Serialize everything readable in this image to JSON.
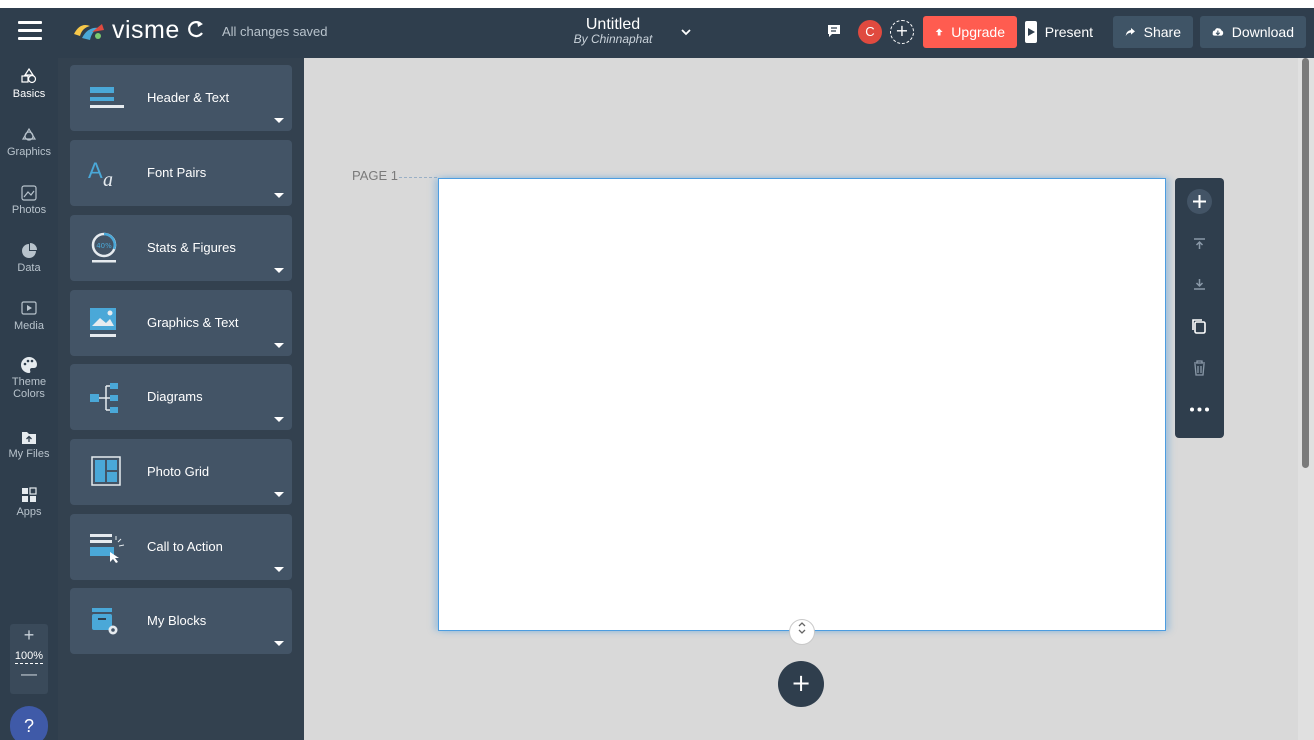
{
  "topbar": {
    "logo": "visme",
    "saved_status": "All changes saved",
    "doc_title": "Untitled",
    "doc_author": "By Chinnaphat",
    "avatar_initial": "C",
    "upgrade": "Upgrade",
    "present": "Present",
    "share": "Share",
    "download": "Download"
  },
  "rail": {
    "items": [
      {
        "label": "Basics",
        "icon": "basics-icon"
      },
      {
        "label": "Graphics",
        "icon": "graphics-icon"
      },
      {
        "label": "Photos",
        "icon": "photos-icon"
      },
      {
        "label": "Data",
        "icon": "data-icon"
      },
      {
        "label": "Media",
        "icon": "media-icon"
      },
      {
        "label": "Theme",
        "label2": "Colors",
        "icon": "palette-icon"
      },
      {
        "label": "My Files",
        "icon": "my-files-icon"
      },
      {
        "label": "Apps",
        "icon": "apps-icon"
      }
    ],
    "zoom_plus": "+",
    "zoom_value": "100%",
    "zoom_minus": "—",
    "help": "?"
  },
  "blocks": [
    {
      "label": "Header & Text"
    },
    {
      "label": "Font Pairs"
    },
    {
      "label": "Stats & Figures"
    },
    {
      "label": "Graphics & Text"
    },
    {
      "label": "Diagrams"
    },
    {
      "label": "Photo Grid"
    },
    {
      "label": "Call to Action"
    },
    {
      "label": "My Blocks"
    }
  ],
  "canvas": {
    "page_label": "PAGE 1",
    "font_pairs_icon_text": "Aa",
    "stats_icon_text": "40%"
  },
  "colors": {
    "topbar": "#2f3e4d",
    "accent_blue": "#4aa8d8",
    "upgrade": "#ff5c50"
  }
}
